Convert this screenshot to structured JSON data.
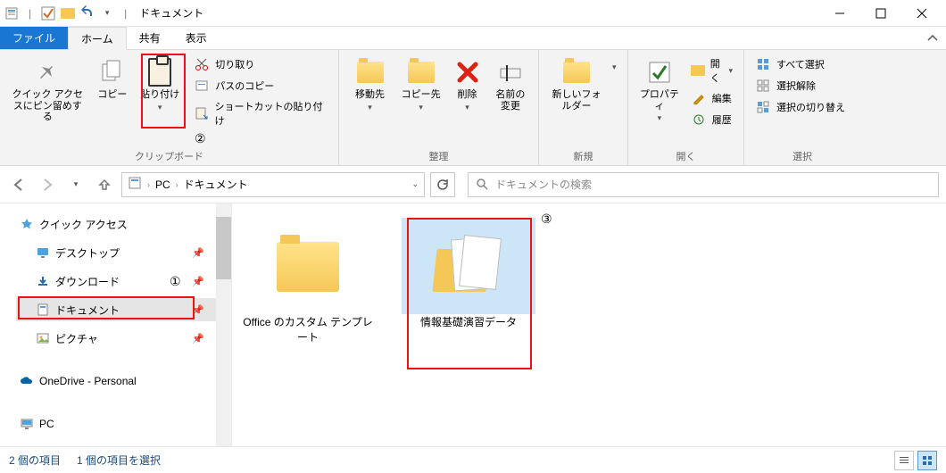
{
  "title": "ドキュメント",
  "tabs": {
    "file": "ファイル",
    "home": "ホーム",
    "share": "共有",
    "view": "表示"
  },
  "ribbon": {
    "clipboard": {
      "pin": "クイック アクセスにピン留めする",
      "copy": "コピー",
      "paste": "貼り付け",
      "cut": "切り取り",
      "copypath": "パスのコピー",
      "pasteshortcut": "ショートカットの貼り付け",
      "group": "クリップボード"
    },
    "organize": {
      "moveto": "移動先",
      "copyto": "コピー先",
      "delete": "削除",
      "rename": "名前の変更",
      "group": "整理"
    },
    "new": {
      "newfolder": "新しいフォルダー",
      "group": "新規"
    },
    "open": {
      "properties": "プロパティ",
      "open": "開く",
      "edit": "編集",
      "history": "履歴",
      "group": "開く"
    },
    "select": {
      "selectall": "すべて選択",
      "selectnone": "選択解除",
      "invert": "選択の切り替え",
      "group": "選択"
    }
  },
  "breadcrumb": {
    "pc": "PC",
    "docs": "ドキュメント"
  },
  "search": {
    "placeholder": "ドキュメントの検索"
  },
  "sidebar": {
    "quickaccess": "クイック アクセス",
    "desktop": "デスクトップ",
    "downloads": "ダウンロード",
    "documents": "ドキュメント",
    "pictures": "ピクチャ",
    "onedrive": "OneDrive - Personal",
    "pc": "PC"
  },
  "files": {
    "item1": "Office のカスタム テンプレート",
    "item2": "情報基礎演習データ"
  },
  "status": {
    "count": "2 個の項目",
    "selected": "1 個の項目を選択"
  },
  "annotations": {
    "n1": "①",
    "n2": "②",
    "n3": "③"
  }
}
